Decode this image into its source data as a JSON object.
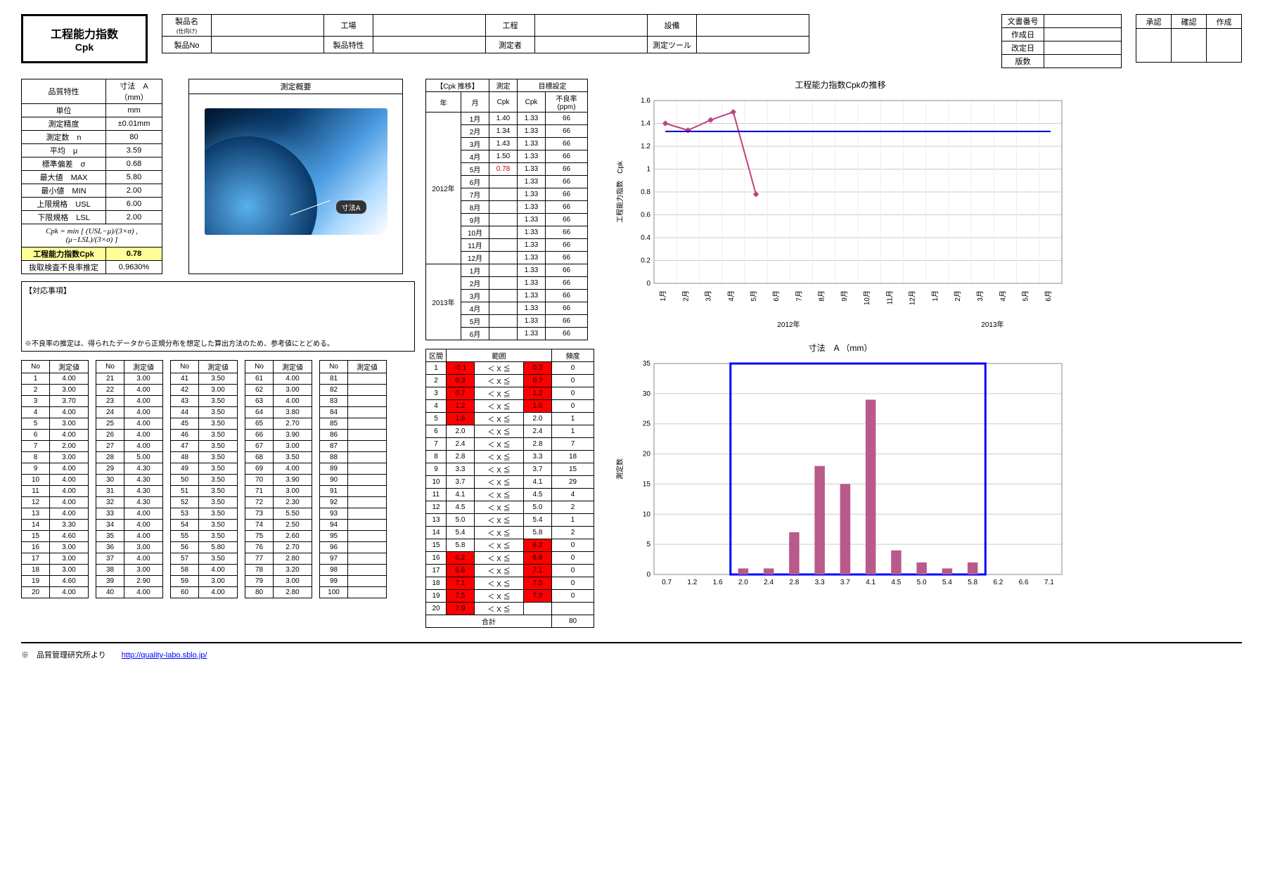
{
  "title": {
    "line1": "工程能力指数",
    "line2": "Cpk"
  },
  "info": {
    "product_name_lbl": "製品名",
    "product_name_sub": "(仕向け)",
    "factory_lbl": "工場",
    "process_lbl": "工程",
    "equipment_lbl": "設備",
    "product_no_lbl": "製品No",
    "product_char_lbl": "製品特性",
    "measurer_lbl": "測定者",
    "tool_lbl": "測定ツール"
  },
  "docmeta": {
    "docno_lbl": "文書番号",
    "created_lbl": "作成日",
    "revised_lbl": "改定日",
    "ver_lbl": "版数"
  },
  "stamps": {
    "approve": "承認",
    "confirm": "確認",
    "create": "作成"
  },
  "stats": {
    "r1l": "品質特性",
    "r1v": "寸法　A （mm）",
    "r2l": "単位",
    "r2v": "mm",
    "r3l": "測定精度",
    "r3v": "±0.01mm",
    "r4l": "測定数　n",
    "r4v": "80",
    "r5l": "平均　μ",
    "r5v": "3.59",
    "r6l": "標準偏差　σ",
    "r6v": "0.68",
    "r7l": "最大値　MAX",
    "r7v": "5.80",
    "r8l": "最小値　MIN",
    "r8v": "2.00",
    "r9l": "上限規格　USL",
    "r9v": "6.00",
    "r10l": "下限規格　LSL",
    "r10v": "2.00",
    "formula": "Cpk = min [ (USL−μ)/(3×σ) , (μ−LSL)/(3×σ) ]",
    "r11l": "工程能力指数Cpk",
    "r11v": "0.78",
    "r12l": "抜取検査不良率推定",
    "r12v": "0.9630%"
  },
  "notes": {
    "title": "【対応事項】",
    "foot": "※不良率の推定は、得られたデータから正規分布を想定した算出方法のため、参考値にとどめる。"
  },
  "img": {
    "title": "測定概要",
    "label": "寸法A"
  },
  "meas_hdr": {
    "no": "No",
    "val": "測定値"
  },
  "meas": {
    "c1": [
      [
        "1",
        "4.00"
      ],
      [
        "2",
        "3.00"
      ],
      [
        "3",
        "3.70"
      ],
      [
        "4",
        "4.00"
      ],
      [
        "5",
        "3.00"
      ],
      [
        "6",
        "4.00"
      ],
      [
        "7",
        "2.00"
      ],
      [
        "8",
        "3.00"
      ],
      [
        "9",
        "4.00"
      ],
      [
        "10",
        "4.00"
      ],
      [
        "11",
        "4.00"
      ],
      [
        "12",
        "4.00"
      ],
      [
        "13",
        "4.00"
      ],
      [
        "14",
        "3.30"
      ],
      [
        "15",
        "4.60"
      ],
      [
        "16",
        "3.00"
      ],
      [
        "17",
        "3.00"
      ],
      [
        "18",
        "3.00"
      ],
      [
        "19",
        "4.60"
      ],
      [
        "20",
        "4.00"
      ]
    ],
    "c2": [
      [
        "21",
        "3.00"
      ],
      [
        "22",
        "4.00"
      ],
      [
        "23",
        "4.00"
      ],
      [
        "24",
        "4.00"
      ],
      [
        "25",
        "4.00"
      ],
      [
        "26",
        "4.00"
      ],
      [
        "27",
        "4.00"
      ],
      [
        "28",
        "5.00"
      ],
      [
        "29",
        "4.30"
      ],
      [
        "30",
        "4.30"
      ],
      [
        "31",
        "4.30"
      ],
      [
        "32",
        "4.30"
      ],
      [
        "33",
        "4.00"
      ],
      [
        "34",
        "4.00"
      ],
      [
        "35",
        "4.00"
      ],
      [
        "36",
        "3.00"
      ],
      [
        "37",
        "4.00"
      ],
      [
        "38",
        "3.00"
      ],
      [
        "39",
        "2.90"
      ],
      [
        "40",
        "4.00"
      ]
    ],
    "c3": [
      [
        "41",
        "3.50"
      ],
      [
        "42",
        "3.00"
      ],
      [
        "43",
        "3.50"
      ],
      [
        "44",
        "3.50"
      ],
      [
        "45",
        "3.50"
      ],
      [
        "46",
        "3.50"
      ],
      [
        "47",
        "3.50"
      ],
      [
        "48",
        "3.50"
      ],
      [
        "49",
        "3.50"
      ],
      [
        "50",
        "3.50"
      ],
      [
        "51",
        "3.50"
      ],
      [
        "52",
        "3.50"
      ],
      [
        "53",
        "3.50"
      ],
      [
        "54",
        "3.50"
      ],
      [
        "55",
        "3.50"
      ],
      [
        "56",
        "5.80"
      ],
      [
        "57",
        "3.50"
      ],
      [
        "58",
        "4.00"
      ],
      [
        "59",
        "3.00"
      ],
      [
        "60",
        "4.00"
      ]
    ],
    "c4": [
      [
        "61",
        "4.00"
      ],
      [
        "62",
        "3.00"
      ],
      [
        "63",
        "4.00"
      ],
      [
        "64",
        "3.80"
      ],
      [
        "65",
        "2.70"
      ],
      [
        "66",
        "3.90"
      ],
      [
        "67",
        "3.00"
      ],
      [
        "68",
        "3.50"
      ],
      [
        "69",
        "4.00"
      ],
      [
        "70",
        "3.90"
      ],
      [
        "71",
        "3.00"
      ],
      [
        "72",
        "2.30"
      ],
      [
        "73",
        "5.50"
      ],
      [
        "74",
        "2.50"
      ],
      [
        "75",
        "2.60"
      ],
      [
        "76",
        "2.70"
      ],
      [
        "77",
        "2.80"
      ],
      [
        "78",
        "3.20"
      ],
      [
        "79",
        "3.00"
      ],
      [
        "80",
        "2.80"
      ]
    ],
    "c5": [
      [
        "81",
        ""
      ],
      [
        "82",
        ""
      ],
      [
        "83",
        ""
      ],
      [
        "84",
        ""
      ],
      [
        "85",
        ""
      ],
      [
        "86",
        ""
      ],
      [
        "87",
        ""
      ],
      [
        "88",
        ""
      ],
      [
        "89",
        ""
      ],
      [
        "90",
        ""
      ],
      [
        "91",
        ""
      ],
      [
        "92",
        ""
      ],
      [
        "93",
        ""
      ],
      [
        "94",
        ""
      ],
      [
        "95",
        ""
      ],
      [
        "96",
        ""
      ],
      [
        "97",
        ""
      ],
      [
        "98",
        ""
      ],
      [
        "99",
        ""
      ],
      [
        "100",
        ""
      ]
    ]
  },
  "trend": {
    "hdr1": "【Cpk 推移】",
    "hdr2": "測定",
    "hdr3": "目標設定",
    "ylbl": "年",
    "mlbl": "月",
    "clbl": "Cpk",
    "tlbl": "Cpk",
    "plbl": "不良率(ppm)",
    "y2012": "2012年",
    "y2013": "2013年",
    "rows2012": [
      [
        "1月",
        "1.40",
        "1.33",
        "66"
      ],
      [
        "2月",
        "1.34",
        "1.33",
        "66"
      ],
      [
        "3月",
        "1.43",
        "1.33",
        "66"
      ],
      [
        "4月",
        "1.50",
        "1.33",
        "66"
      ],
      [
        "5月",
        "0.78",
        "1.33",
        "66"
      ],
      [
        "6月",
        "",
        "1.33",
        "66"
      ],
      [
        "7月",
        "",
        "1.33",
        "66"
      ],
      [
        "8月",
        "",
        "1.33",
        "66"
      ],
      [
        "9月",
        "",
        "1.33",
        "66"
      ],
      [
        "10月",
        "",
        "1.33",
        "66"
      ],
      [
        "11月",
        "",
        "1.33",
        "66"
      ],
      [
        "12月",
        "",
        "1.33",
        "66"
      ]
    ],
    "rows2013": [
      [
        "1月",
        "",
        "1.33",
        "66"
      ],
      [
        "2月",
        "",
        "1.33",
        "66"
      ],
      [
        "3月",
        "",
        "1.33",
        "66"
      ],
      [
        "4月",
        "",
        "1.33",
        "66"
      ],
      [
        "5月",
        "",
        "1.33",
        "66"
      ],
      [
        "6月",
        "",
        "1.33",
        "66"
      ]
    ]
  },
  "hist": {
    "hdr_kukan": "区間",
    "hdr_hani": "範囲",
    "hdr_hindo": "頻度",
    "sym": "＜ X ≦",
    "total_lbl": "合計",
    "total": "80",
    "rows": [
      {
        "n": "1",
        "lb": "-0.1",
        "ub": "0.3",
        "f": "0",
        "out": true
      },
      {
        "n": "2",
        "lb": "0.3",
        "ub": "0.7",
        "f": "0",
        "out": true
      },
      {
        "n": "3",
        "lb": "0.7",
        "ub": "1.2",
        "f": "0",
        "out": true
      },
      {
        "n": "4",
        "lb": "1.2",
        "ub": "1.6",
        "f": "0",
        "out": true
      },
      {
        "n": "5",
        "lb": "1.6",
        "ub": "2.0",
        "f": "1",
        "out_lb": true
      },
      {
        "n": "6",
        "lb": "2.0",
        "ub": "2.4",
        "f": "1"
      },
      {
        "n": "7",
        "lb": "2.4",
        "ub": "2.8",
        "f": "7"
      },
      {
        "n": "8",
        "lb": "2.8",
        "ub": "3.3",
        "f": "18"
      },
      {
        "n": "9",
        "lb": "3.3",
        "ub": "3.7",
        "f": "15"
      },
      {
        "n": "10",
        "lb": "3.7",
        "ub": "4.1",
        "f": "29"
      },
      {
        "n": "11",
        "lb": "4.1",
        "ub": "4.5",
        "f": "4"
      },
      {
        "n": "12",
        "lb": "4.5",
        "ub": "5.0",
        "f": "2"
      },
      {
        "n": "13",
        "lb": "5.0",
        "ub": "5.4",
        "f": "1"
      },
      {
        "n": "14",
        "lb": "5.4",
        "ub": "5.8",
        "f": "2"
      },
      {
        "n": "15",
        "lb": "5.8",
        "ub": "6.2",
        "f": "0",
        "out_ub": true
      },
      {
        "n": "16",
        "lb": "6.2",
        "ub": "6.6",
        "f": "0",
        "out": true
      },
      {
        "n": "17",
        "lb": "6.6",
        "ub": "7.1",
        "f": "0",
        "out": true
      },
      {
        "n": "18",
        "lb": "7.1",
        "ub": "7.5",
        "f": "0",
        "out": true
      },
      {
        "n": "19",
        "lb": "7.5",
        "ub": "7.9",
        "f": "0",
        "out": true
      },
      {
        "n": "20",
        "lb": "7.9",
        "ub": "",
        "f": "",
        "out_lb": true
      }
    ]
  },
  "chart_data": [
    {
      "type": "line",
      "title": "工程能力指数Cpkの推移",
      "ylabel": "工程能力指数　Cpk",
      "ylim": [
        0,
        1.6
      ],
      "yticks": [
        0,
        0.2,
        0.4,
        0.6,
        0.8,
        1.0,
        1.2,
        1.4,
        1.6
      ],
      "x_categories": [
        "1月",
        "2月",
        "3月",
        "4月",
        "5月",
        "6月",
        "7月",
        "8月",
        "9月",
        "10月",
        "11月",
        "12月",
        "1月",
        "2月",
        "3月",
        "4月",
        "5月",
        "6月"
      ],
      "x_groups": [
        "2012年",
        "2013年"
      ],
      "series": [
        {
          "name": "測定",
          "color": "#c04080",
          "values": [
            1.4,
            1.34,
            1.43,
            1.5,
            0.78,
            null,
            null,
            null,
            null,
            null,
            null,
            null,
            null,
            null,
            null,
            null,
            null,
            null
          ]
        },
        {
          "name": "目標",
          "color": "#0000cc",
          "values": [
            1.33,
            1.33,
            1.33,
            1.33,
            1.33,
            1.33,
            1.33,
            1.33,
            1.33,
            1.33,
            1.33,
            1.33,
            1.33,
            1.33,
            1.33,
            1.33,
            1.33,
            1.33
          ]
        }
      ]
    },
    {
      "type": "bar",
      "title": "寸法　A （mm）",
      "ylabel": "測定数",
      "ylim": [
        0,
        35
      ],
      "yticks": [
        0,
        5,
        10,
        15,
        20,
        25,
        30,
        35
      ],
      "categories": [
        "0.7",
        "1.2",
        "1.6",
        "2.0",
        "2.4",
        "2.8",
        "3.3",
        "3.7",
        "4.1",
        "4.5",
        "5.0",
        "5.4",
        "5.8",
        "6.2",
        "6.6",
        "7.1"
      ],
      "values": [
        0,
        0,
        0,
        1,
        1,
        7,
        18,
        15,
        29,
        4,
        2,
        1,
        2,
        0,
        0,
        0
      ],
      "spec_box": {
        "enabled": true,
        "color": "#0000ff",
        "x_from": "2.0",
        "x_to": "5.8"
      }
    }
  ],
  "footer": {
    "text": "※　品質管理研究所より",
    "link": "http://quality-labo.sblo.jp/"
  }
}
